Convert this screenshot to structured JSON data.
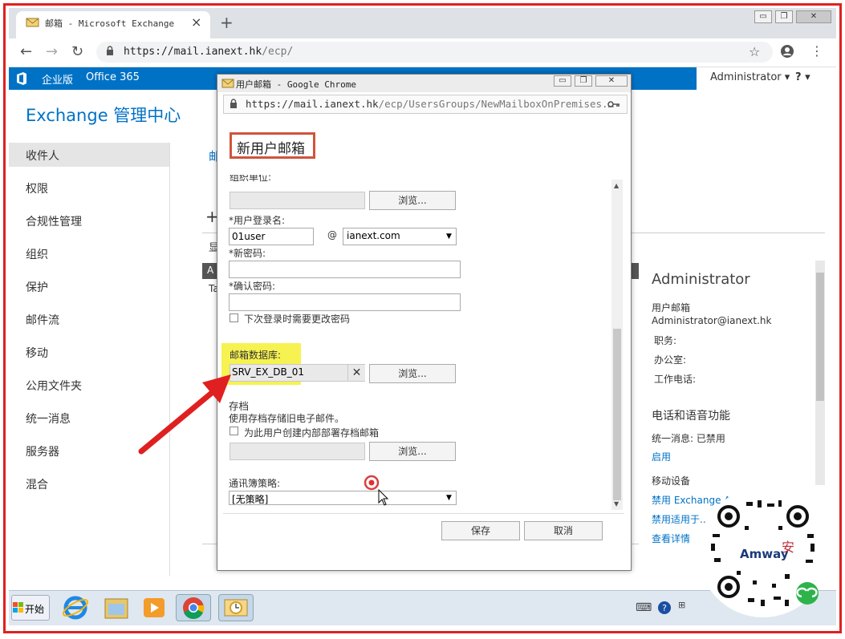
{
  "browser": {
    "tab_title": "邮箱 - Microsoft Exchange",
    "tab_close": "×",
    "new_tab": "+",
    "url_host": "https://mail.ianext.hk",
    "url_path": "/ecp/",
    "window_buttons": [
      "▭",
      "❐",
      "✕"
    ]
  },
  "exchange_bar": {
    "logo_text": "企业版",
    "suite": "Office 365",
    "user": "Administrator ▾",
    "help": "? ▾"
  },
  "page": {
    "title": "Exchange 管理中心",
    "nav": [
      "收件人",
      "权限",
      "合规性管理",
      "组织",
      "保护",
      "邮件流",
      "移动",
      "公用文件夹",
      "统一消息",
      "服务器",
      "混合"
    ],
    "selected_nav": "收件人",
    "behind_dialog_fragments": [
      "邮",
      "+",
      "显",
      "A",
      "Ta"
    ]
  },
  "details": {
    "name": "Administrator",
    "type": "用户邮箱",
    "email": "Administrator@ianext.hk",
    "fields": [
      "职务:",
      "办公室:",
      "工作电话:"
    ],
    "section": "电话和语音功能",
    "um_label": "统一消息: 已禁用",
    "um_link": "启用",
    "mobile_label": "移动设备",
    "mobile_links": [
      "禁用 Exchange Ac...",
      "禁用适用于...",
      "查看详情"
    ]
  },
  "dialog": {
    "window_title": "用户邮箱 - Google Chrome",
    "url_host": "https://mail.ianext.hk",
    "url_path": "/ecp/UsersGroups/NewMailboxOnPremises.…",
    "heading": "新用户邮箱",
    "org_unit_label": "组织单位:",
    "browse": "浏览...",
    "logon_label": "*用户登录名:",
    "logon_value": "01user",
    "at": "@",
    "domain_value": "ianext.com",
    "new_password_label": "*新密码:",
    "confirm_password_label": "*确认密码:",
    "require_change_label": "下次登录时需要更改密码",
    "mailbox_db_label": "邮箱数据库:",
    "mailbox_db_value": "SRV_EX_DB_01",
    "clear_icon": "✕",
    "archive_label": "存档",
    "archive_desc": "使用存档存储旧电子邮件。",
    "archive_checkbox_label": "为此用户创建内部部署存档邮箱",
    "abp_label": "通讯簿策略:",
    "abp_value": "[无策略]",
    "save": "保存",
    "cancel": "取消"
  },
  "taskbar": {
    "start": "开始",
    "apps": [
      "internet-explorer-icon",
      "folder-icon",
      "media-player-icon",
      "chrome-icon",
      "outlook-icon"
    ]
  },
  "watermark": {
    "brand": "Amway"
  },
  "colors": {
    "exchange_blue": "#0072c6",
    "frame_red": "#e02020",
    "highlight_yellow": "#f5f032",
    "heading_border": "#d0543c"
  }
}
